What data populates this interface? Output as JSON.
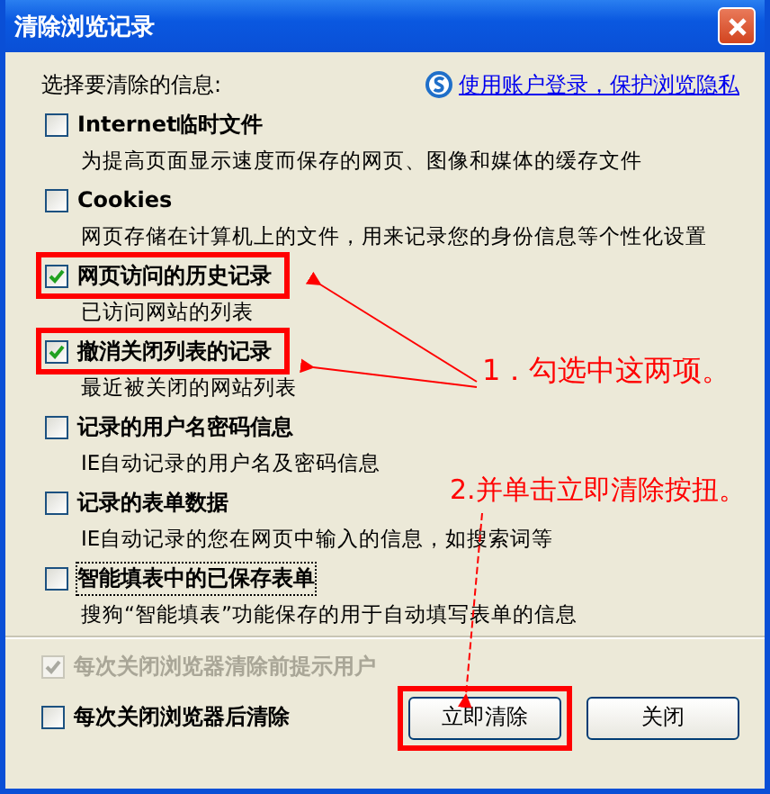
{
  "window": {
    "title": "清除浏览记录"
  },
  "header": {
    "label": "选择要清除的信息:",
    "link": "使用账户登录，保护浏览隐私"
  },
  "options": [
    {
      "label": "Internet临时文件",
      "description": "为提高页面显示速度而保存的网页、图像和媒体的缓存文件",
      "checked": false,
      "highlighted": false,
      "focused": false
    },
    {
      "label": "Cookies",
      "description": "网页存储在计算机上的文件，用来记录您的身份信息等个性化设置",
      "checked": false,
      "highlighted": false,
      "focused": false
    },
    {
      "label": "网页访问的历史记录",
      "description": "已访问网站的列表",
      "checked": true,
      "highlighted": true,
      "focused": false
    },
    {
      "label": "撤消关闭列表的记录",
      "description": "最近被关闭的网站列表",
      "checked": true,
      "highlighted": true,
      "focused": false
    },
    {
      "label": "记录的用户名密码信息",
      "description": "IE自动记录的用户名及密码信息",
      "checked": false,
      "highlighted": false,
      "focused": false
    },
    {
      "label": "记录的表单数据",
      "description": "IE自动记录的您在网页中输入的信息，如搜索词等",
      "checked": false,
      "highlighted": false,
      "focused": false
    },
    {
      "label": "智能填表中的已保存表单",
      "description": "搜狗“智能填表”功能保存的用于自动填写表单的信息",
      "checked": false,
      "highlighted": false,
      "focused": true
    }
  ],
  "footer_options": [
    {
      "label": "每次关闭浏览器清除前提示用户",
      "checked": true,
      "disabled": true
    },
    {
      "label": "每次关闭浏览器后清除",
      "checked": false,
      "disabled": false
    }
  ],
  "buttons": [
    {
      "label": "立即清除",
      "highlighted": true
    },
    {
      "label": "关闭",
      "highlighted": false
    }
  ],
  "annotations": [
    {
      "text": "1．勾选中这两项。"
    },
    {
      "text": "2.并单击立即清除按扭。"
    }
  ]
}
